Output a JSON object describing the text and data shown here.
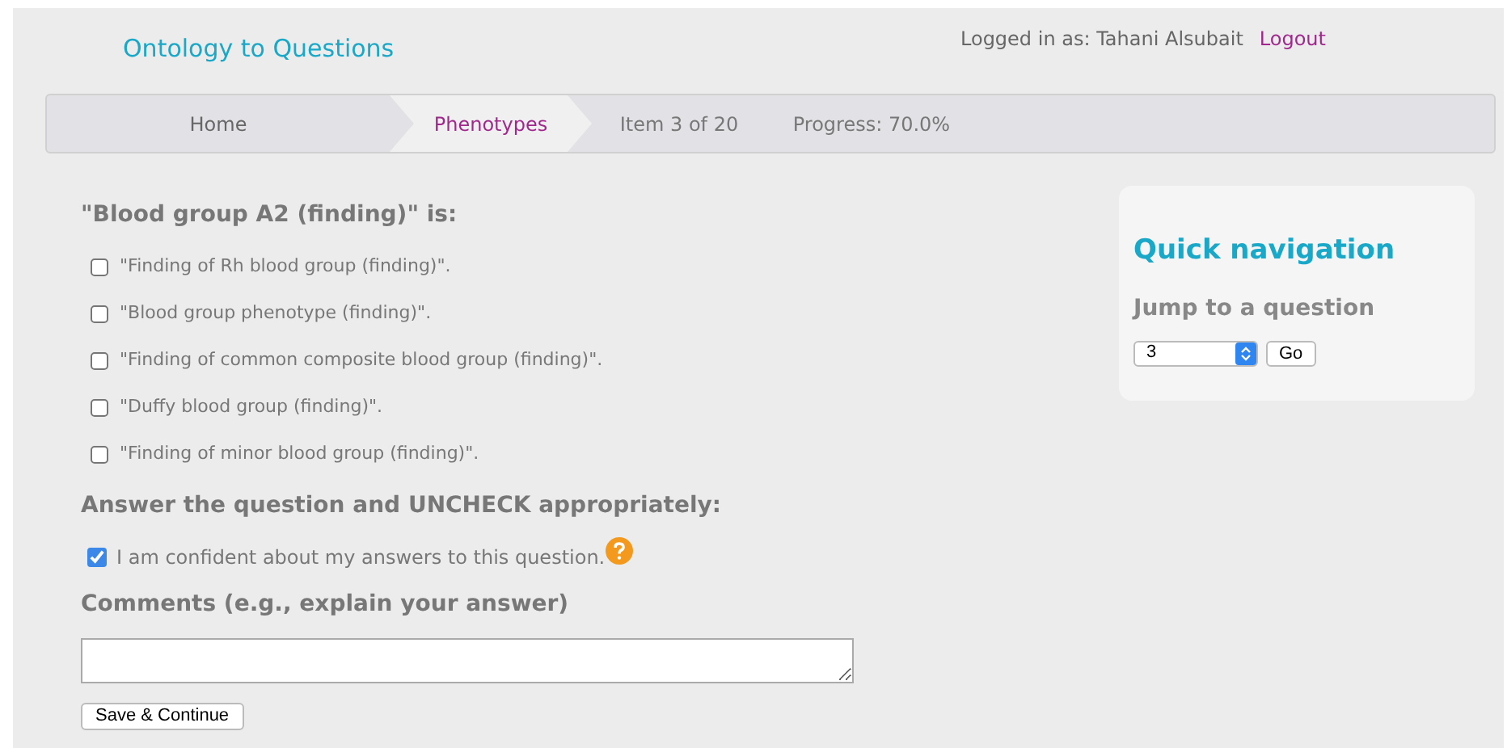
{
  "header": {
    "title": "Ontology to Questions",
    "login_label": "Logged in as: Tahani Alsubait",
    "logout": "Logout"
  },
  "breadcrumb": [
    {
      "label": "Home",
      "kind": "link",
      "selected": false
    },
    {
      "label": "Phenotypes",
      "kind": "link",
      "selected": true
    },
    {
      "label": "Item 3 of 20",
      "kind": "text",
      "selected": false
    },
    {
      "label": "Progress: 70.0%",
      "kind": "text",
      "selected": false
    }
  ],
  "question": {
    "title": "\"Blood group A2 (finding)\" is:",
    "options": [
      {
        "label": "\"Finding of Rh blood group (finding)\".",
        "checked": false
      },
      {
        "label": "\"Blood group phenotype (finding)\".",
        "checked": false
      },
      {
        "label": "\"Finding of common composite blood group (finding)\".",
        "checked": false
      },
      {
        "label": "\"Duffy blood group (finding)\".",
        "checked": false
      },
      {
        "label": "\"Finding of minor blood group (finding)\".",
        "checked": false
      }
    ]
  },
  "instruction": "Answer the question and UNCHECK appropriately:",
  "confidence": {
    "label": "I am confident about my answers to this question.",
    "checked": true
  },
  "comments": {
    "label": "Comments (e.g., explain your answer)"
  },
  "save_button": "Save & Continue",
  "quick_navigation": {
    "title": "Quick navigation",
    "subtitle": "Jump to a question",
    "select_value": "3",
    "go_button": "Go"
  }
}
